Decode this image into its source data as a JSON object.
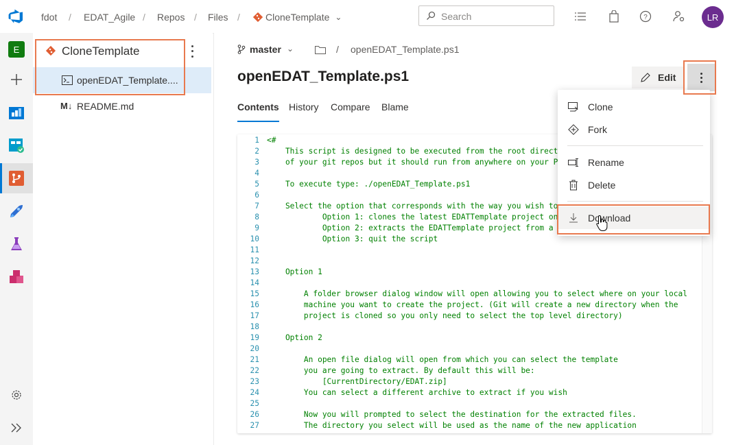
{
  "breadcrumbs": [
    "fdot",
    "EDAT_Agile",
    "Repos",
    "Files",
    "CloneTemplate"
  ],
  "search": {
    "placeholder": "Search"
  },
  "user": {
    "initials": "LR"
  },
  "rail": {
    "project_initial": "E"
  },
  "tree": {
    "repo_name": "CloneTemplate",
    "items": [
      {
        "label": "openEDAT_Template....",
        "selected": true,
        "icon": "powershell-file-icon"
      },
      {
        "label": "README.md",
        "selected": false,
        "icon": "markdown-file-icon"
      }
    ]
  },
  "main": {
    "branch": "master",
    "path_sep": "/",
    "path_file": "openEDAT_Template.ps1",
    "file_title": "openEDAT_Template.ps1",
    "edit_label": "Edit",
    "tabs": [
      "Contents",
      "History",
      "Compare",
      "Blame"
    ],
    "active_tab": "Contents"
  },
  "code": {
    "lines": [
      {
        "n": "1",
        "t": "<#"
      },
      {
        "n": "2",
        "t": "    This script is designed to be executed from the root directory"
      },
      {
        "n": "3",
        "t": "    of your git repos but it should run from anywhere on your PC"
      },
      {
        "n": "4",
        "t": ""
      },
      {
        "n": "5",
        "t": "    To execute type: ./openEDAT_Template.ps1"
      },
      {
        "n": "6",
        "t": ""
      },
      {
        "n": "7",
        "t": "    Select the option that corresponds with the way you wish to"
      },
      {
        "n": "8",
        "t": "            Option 1: clones the latest EDATTemplate project onto"
      },
      {
        "n": "9",
        "t": "            Option 2: extracts the EDATTemplate project from a zip"
      },
      {
        "n": "10",
        "t": "            Option 3: quit the script"
      },
      {
        "n": "11",
        "t": ""
      },
      {
        "n": "12",
        "t": ""
      },
      {
        "n": "13",
        "t": "    Option 1"
      },
      {
        "n": "14",
        "t": ""
      },
      {
        "n": "15",
        "t": "        A folder browser dialog window will open allowing you to select where on your local"
      },
      {
        "n": "16",
        "t": "        machine you want to create the project. (Git will create a new directory when the"
      },
      {
        "n": "17",
        "t": "        project is cloned so you only need to select the top level directory)"
      },
      {
        "n": "18",
        "t": ""
      },
      {
        "n": "19",
        "t": "    Option 2"
      },
      {
        "n": "20",
        "t": ""
      },
      {
        "n": "21",
        "t": "        An open file dialog will open from which you can select the template"
      },
      {
        "n": "22",
        "t": "        you are going to extract. By default this will be:"
      },
      {
        "n": "23",
        "t": "            [CurrentDirectory/EDAT.zip]"
      },
      {
        "n": "24",
        "t": "        You can select a different archive to extract if you wish"
      },
      {
        "n": "25",
        "t": ""
      },
      {
        "n": "26",
        "t": "        Now you will prompted to select the destination for the extracted files."
      },
      {
        "n": "27",
        "t": "        The directory you select will be used as the name of the new application"
      }
    ]
  },
  "menu": {
    "items": [
      {
        "label": "Clone",
        "icon": "clone-icon"
      },
      {
        "label": "Fork",
        "icon": "fork-icon"
      },
      {
        "label": "Rename",
        "icon": "rename-icon"
      },
      {
        "label": "Delete",
        "icon": "trash-icon"
      },
      {
        "label": "Download",
        "icon": "download-icon"
      }
    ]
  },
  "colors": {
    "accent": "#0078d4",
    "highlight": "#e8794e",
    "repo_icon": "#e05d32"
  }
}
